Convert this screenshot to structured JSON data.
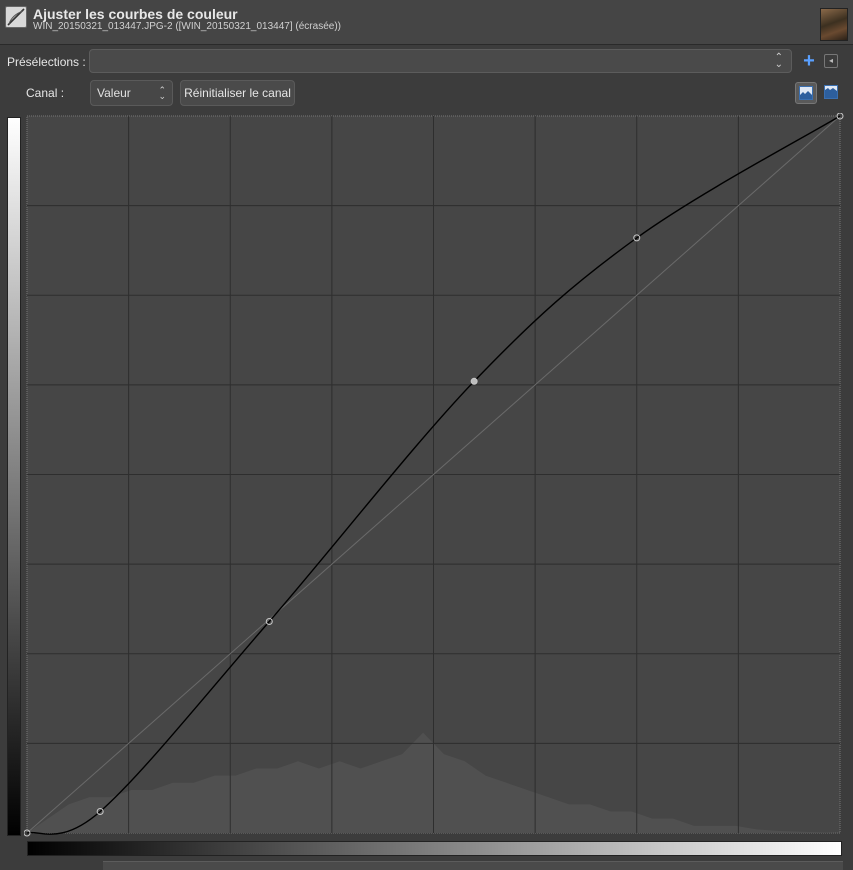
{
  "header": {
    "title": "Ajuster les courbes de couleur",
    "subtitle": "WIN_20150321_013447.JPG-2 ([WIN_20150321_013447] (écrasée))"
  },
  "presets": {
    "label": "Présélections :",
    "value": "",
    "add_icon": "plus-icon",
    "menu_icon": "menu-icon"
  },
  "channel": {
    "label": "Canal :",
    "value": "Valeur",
    "reset_label": "Réinitialiser le canal"
  },
  "histogram_scale": {
    "linear_icon": "linear-histogram-icon",
    "log_icon": "logarithmic-histogram-icon",
    "selected": "linear"
  },
  "curve": {
    "channel": "Valeur",
    "points": [
      [
        0,
        0
      ],
      [
        0.09,
        0.03
      ],
      [
        0.298,
        0.295
      ],
      [
        0.55,
        0.63
      ],
      [
        0.75,
        0.83
      ],
      [
        1,
        1
      ]
    ],
    "selected_point_index": 3,
    "grid_divisions": 8,
    "colors": {
      "background": "#464646",
      "grid": "#2e2e2e",
      "curve": "#000000",
      "diagonal": "#6a6a6a",
      "histogram": "#505050"
    }
  },
  "histogram": {
    "values": [
      0.0,
      0.02,
      0.04,
      0.05,
      0.05,
      0.06,
      0.06,
      0.07,
      0.07,
      0.08,
      0.08,
      0.09,
      0.09,
      0.1,
      0.09,
      0.1,
      0.09,
      0.1,
      0.11,
      0.14,
      0.11,
      0.1,
      0.08,
      0.07,
      0.06,
      0.05,
      0.04,
      0.04,
      0.03,
      0.03,
      0.02,
      0.02,
      0.01,
      0.01,
      0.01,
      0.005,
      0.003,
      0.002,
      0.001,
      0.0
    ]
  }
}
